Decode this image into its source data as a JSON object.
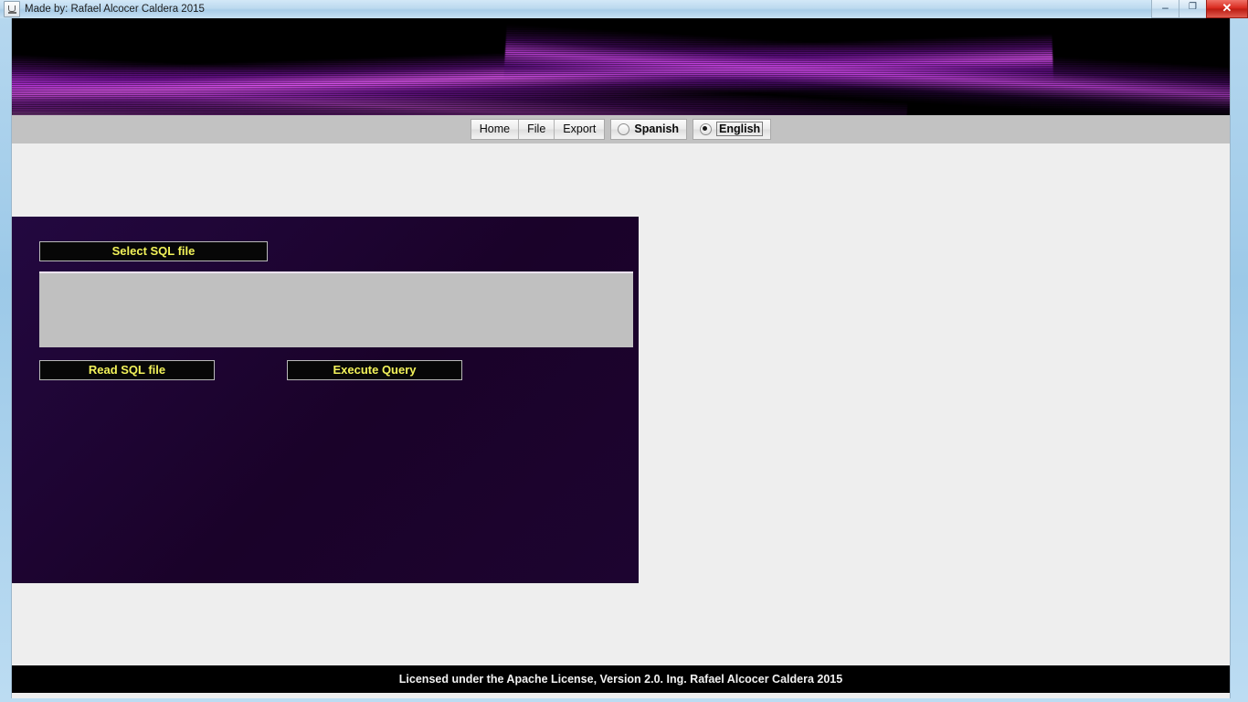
{
  "window": {
    "title": "Made by: Rafael Alcocer Caldera 2015",
    "app_icon": "java-coffee-cup-icon",
    "controls": {
      "minimize_label": "–",
      "maximize_label": "❐",
      "close_label": "✕"
    }
  },
  "banner": {
    "alt": "purple-light-streaks-banner",
    "background_color": "#000000",
    "accent_color": "#e256f5"
  },
  "navbar": {
    "menu_items": [
      {
        "label": "Home",
        "name": "nav-home"
      },
      {
        "label": "File",
        "name": "nav-file"
      },
      {
        "label": "Export",
        "name": "nav-export"
      }
    ],
    "language_options": [
      {
        "label": "Spanish",
        "selected": false
      },
      {
        "label": "English",
        "selected": true
      }
    ]
  },
  "main": {
    "panel_background": "#1c0330",
    "button_text_color": "#f2f25a",
    "buttons": {
      "select_sql_file": "Select SQL file",
      "read_sql_file": "Read SQL file",
      "execute_query": "Execute Query"
    },
    "sql_list": {
      "name": "sql-file-list",
      "value": "",
      "background_color": "#c0c0c0"
    }
  },
  "footer": {
    "text": "Licensed under the Apache License, Version 2.0. Ing. Rafael Alcocer Caldera 2015"
  }
}
